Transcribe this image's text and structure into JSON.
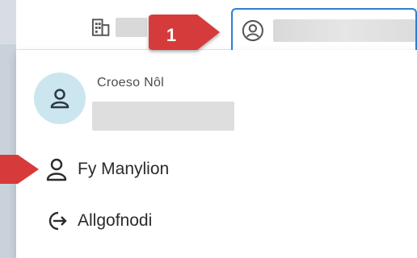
{
  "header": {
    "org_icon": "building-icon",
    "account_icon": "user-circle-icon"
  },
  "menu": {
    "welcome": "Croeso Nôl",
    "items": [
      {
        "label": "Fy Manylion",
        "icon": "user-icon"
      },
      {
        "label": "Allgofnodi",
        "icon": "logout-icon"
      }
    ]
  },
  "annotations": {
    "step_number": "1",
    "accent": "#d63a3a"
  },
  "colors": {
    "focus_border": "#2d7fd3",
    "avatar_bg": "#cbe6ef"
  }
}
